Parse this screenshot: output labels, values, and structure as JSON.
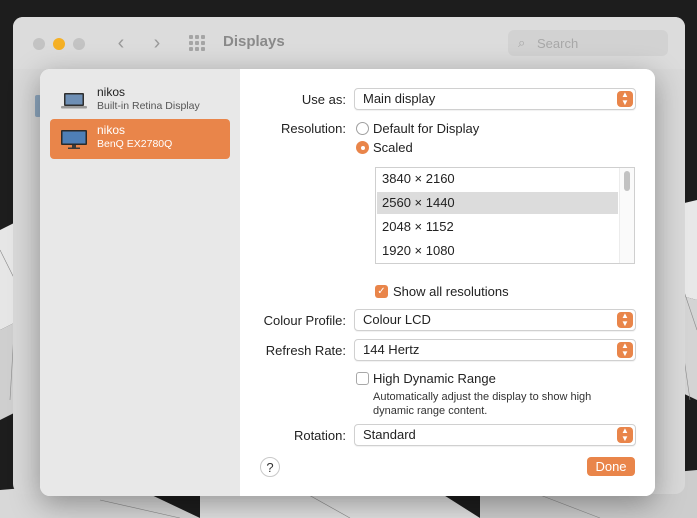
{
  "window": {
    "title": "Displays",
    "search_placeholder": "Search",
    "back_icon": "chevron-left-icon",
    "forward_icon": "chevron-right-icon",
    "grid_icon": "grid-icon",
    "accent_color": "#e9854a"
  },
  "sidebar": {
    "displays": [
      {
        "name": "nikos",
        "subtitle": "Built-in Retina Display",
        "icon": "laptop-icon",
        "selected": false
      },
      {
        "name": "nikos",
        "subtitle": "BenQ EX2780Q",
        "icon": "monitor-icon",
        "selected": true
      }
    ]
  },
  "settings": {
    "use_as": {
      "label": "Use as:",
      "value": "Main display"
    },
    "resolution": {
      "label": "Resolution:",
      "options": [
        {
          "label": "Default for Display",
          "selected": false
        },
        {
          "label": "Scaled",
          "selected": true
        }
      ],
      "list": [
        "3840 × 2160",
        "2560 × 1440",
        "2048 × 1152",
        "1920 × 1080"
      ],
      "selected_value": "2560 × 1440"
    },
    "show_all_resolutions": {
      "label": "Show all resolutions",
      "checked": true
    },
    "colour_profile": {
      "label": "Colour Profile:",
      "value": "Colour LCD"
    },
    "refresh_rate": {
      "label": "Refresh Rate:",
      "value": "144 Hertz"
    },
    "hdr": {
      "label": "High Dynamic Range",
      "checked": false,
      "description": "Automatically adjust the display to show high dynamic range content."
    },
    "rotation": {
      "label": "Rotation:",
      "value": "Standard"
    }
  },
  "footer": {
    "help_label": "?",
    "done_label": "Done"
  }
}
